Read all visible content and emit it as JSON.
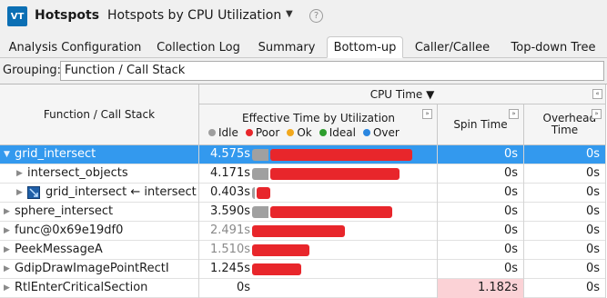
{
  "app": {
    "logo": "VT",
    "title": "Hotspots",
    "analysis": "Hotspots by CPU Utilization",
    "help": "?"
  },
  "tabs": [
    {
      "label": "Analysis Configuration",
      "active": false
    },
    {
      "label": "Collection Log",
      "active": false
    },
    {
      "label": "Summary",
      "active": false
    },
    {
      "label": "Bottom-up",
      "active": true
    },
    {
      "label": "Caller/Callee",
      "active": false
    },
    {
      "label": "Top-down Tree",
      "active": false
    }
  ],
  "grouping": {
    "label": "Grouping:",
    "value": "Function / Call Stack"
  },
  "grid": {
    "headers": {
      "function": "Function / Call Stack",
      "cpu_time": "CPU Time ▼",
      "effective": "Effective Time by Utilization",
      "spin": "Spin Time",
      "overhead": "Overhead Time"
    },
    "legend": [
      {
        "label": "Idle",
        "color": "#9e9e9e"
      },
      {
        "label": "Poor",
        "color": "#e8262b"
      },
      {
        "label": "Ok",
        "color": "#f2a81d"
      },
      {
        "label": "Ideal",
        "color": "#2e9e2e"
      },
      {
        "label": "Over",
        "color": "#2a86e0"
      }
    ],
    "rows": [
      {
        "name": "grid_intersect",
        "effective": "4.575s",
        "spin": "0s",
        "overhead": "0s",
        "idle_frac": 0.09,
        "poor_frac": 0.64,
        "selected": true,
        "level": 0,
        "expanded": true,
        "faded": false
      },
      {
        "name": "intersect_objects",
        "effective": "4.171s",
        "spin": "0s",
        "overhead": "0s",
        "idle_frac": 0.09,
        "poor_frac": 0.58,
        "selected": false,
        "level": 1,
        "expanded": false,
        "faded": false
      },
      {
        "name": "grid_intersect ← intersect",
        "effective": "0.403s",
        "spin": "0s",
        "overhead": "0s",
        "idle_frac": 0.01,
        "poor_frac": 0.06,
        "selected": false,
        "level": 1,
        "expanded": false,
        "faded": false,
        "icon": "function-icon"
      },
      {
        "name": "sphere_intersect",
        "effective": "3.590s",
        "spin": "0s",
        "overhead": "0s",
        "idle_frac": 0.09,
        "poor_frac": 0.55,
        "selected": false,
        "level": 0,
        "expanded": false,
        "faded": false
      },
      {
        "name": "func@0x69e19df0",
        "effective": "2.491s",
        "spin": "0s",
        "overhead": "0s",
        "idle_frac": 0.0,
        "poor_frac": 0.42,
        "selected": false,
        "level": 0,
        "expanded": false,
        "faded": true
      },
      {
        "name": "PeekMessageA",
        "effective": "1.510s",
        "spin": "0s",
        "overhead": "0s",
        "idle_frac": 0.0,
        "poor_frac": 0.26,
        "selected": false,
        "level": 0,
        "expanded": false,
        "faded": true
      },
      {
        "name": "GdipDrawImagePointRectI",
        "effective": "1.245s",
        "spin": "0s",
        "overhead": "0s",
        "idle_frac": 0.0,
        "poor_frac": 0.22,
        "selected": false,
        "level": 0,
        "expanded": false,
        "faded": false
      },
      {
        "name": "RtlEnterCriticalSection",
        "effective": "0s",
        "spin": "1.182s",
        "overhead": "0s",
        "idle_frac": 0.0,
        "poor_frac": 0.0,
        "selected": false,
        "level": 0,
        "expanded": false,
        "faded": false,
        "spin_hot": true
      }
    ]
  }
}
